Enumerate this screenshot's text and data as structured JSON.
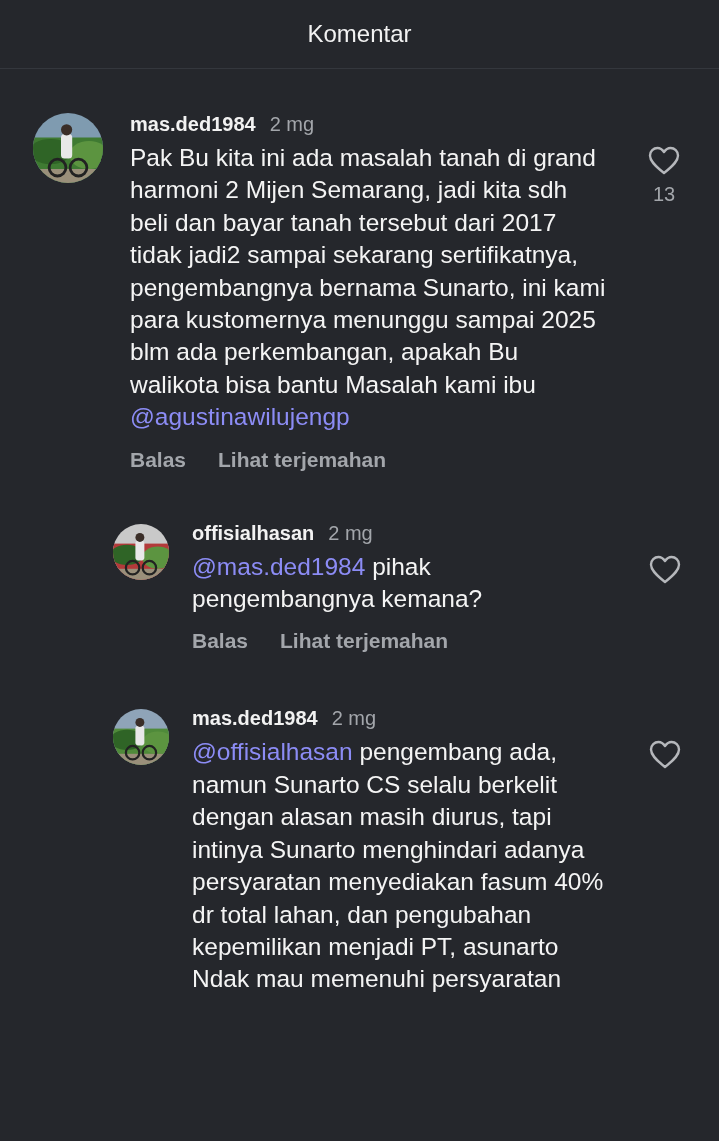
{
  "header": {
    "title": "Komentar"
  },
  "comments": [
    {
      "kind": "comment",
      "username": "mas.ded1984",
      "time": "2 mg",
      "text": "Pak Bu kita ini ada masalah tanah di grand harmoni 2 Mijen Semarang, jadi kita sdh beli dan bayar tanah tersebut dari 2017 tidak jadi2 sampai sekarang sertifikatnya, pengembangnya bernama Sunarto, ini kami para kustomernya menunggu sampai 2025 blm ada perkembangan, apakah Bu walikota bisa bantu Masalah kami ibu",
      "mention_after": "@agustinawilujengp",
      "likes": "13",
      "actions": [
        "Balas",
        "Lihat terjemahan"
      ]
    },
    {
      "kind": "reply",
      "username": "offisialhasan",
      "time": "2 mg",
      "mention_before": "@mas.ded1984",
      "text": "pihak pengembangnya kemana?",
      "actions": [
        "Balas",
        "Lihat terjemahan"
      ]
    },
    {
      "kind": "reply",
      "username": "mas.ded1984",
      "time": "2 mg",
      "mention_before": "@offisialhasan",
      "text": "pengembang ada, namun Sunarto CS selalu berkelit dengan alasan masih diurus, tapi intinya Sunarto menghindari  adanya persyaratan menyediakan fasum 40% dr total lahan, dan pengubahan kepemilikan menjadi PT, asunarto Ndak mau memenuhi persyaratan"
    }
  ]
}
